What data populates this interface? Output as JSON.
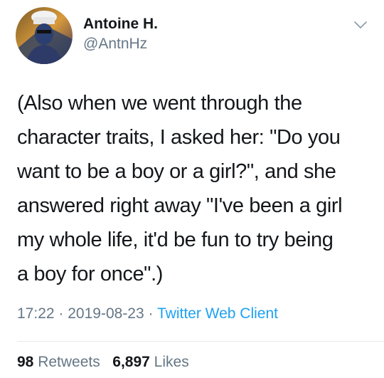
{
  "user": {
    "display_name": "Antoine H.",
    "handle": "@AntnHz",
    "avatar_icon": "chef-avatar-icon"
  },
  "menu": {
    "icon": "chevron-down-icon"
  },
  "tweet": {
    "lines": [
      "(Also when we went through the",
      "character traits, I asked her: \"Do you",
      "want to be a boy or a girl?\", and she",
      "answered right away \"I've been a girl",
      "my whole life, it'd be fun to try being",
      "a boy for once\".)"
    ]
  },
  "meta": {
    "time": "17:22",
    "separator": "·",
    "date": "2019-08-23",
    "source": "Twitter Web Client"
  },
  "stats": {
    "retweets_count": "98",
    "retweets_label": "Retweets",
    "likes_count": "6,897",
    "likes_label": "Likes"
  },
  "colors": {
    "text": "#14171a",
    "secondary": "#657786",
    "link": "#1da1f2",
    "divider": "#e6ecf0"
  }
}
